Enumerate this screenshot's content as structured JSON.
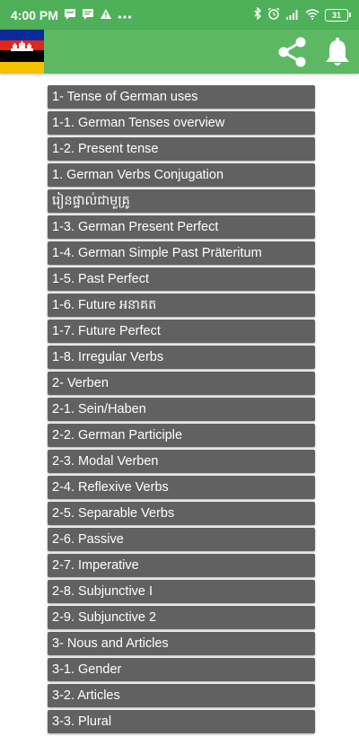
{
  "status_bar": {
    "time": "4:00 PM",
    "left_icons": [
      "message-icon",
      "message-icon",
      "warning-icon",
      "more-dots-icon"
    ],
    "right_icons": [
      "bluetooth-icon",
      "alarm-icon",
      "signal-icon",
      "wifi-icon",
      "battery-icon"
    ],
    "battery_level": "31"
  },
  "app_bar": {
    "icons": [
      "flag-icon",
      "share-icon",
      "bell-icon"
    ],
    "color": "#5db864"
  },
  "lessons": [
    "1- Tense of German uses",
    "1-1. German Tenses overview",
    "1-2. Present tense",
    "1. German Verbs Conjugation",
    "រៀនផ្ទាល់ជាមួគ្រូ",
    "1-3. German Present Perfect",
    "1-4. German Simple Past Präteritum",
    "1-5. Past Perfect",
    "1-6. Future អនាគត",
    "1-7. Future Perfect",
    "1-8. Irregular Verbs",
    "2- Verben",
    "2-1. Sein/Haben",
    "2-2. German Participle",
    "2-3. Modal Verben",
    "2-4. Reflexive Verbs",
    "2-5. Separable Verbs",
    "2-6. Passive",
    "2-7. Imperative",
    "2-8. Subjunctive I",
    "2-9. Subjunctive 2",
    "3- Nous and Articles",
    "3-1. Gender",
    "3-2. Articles",
    "3-3. Plural"
  ]
}
